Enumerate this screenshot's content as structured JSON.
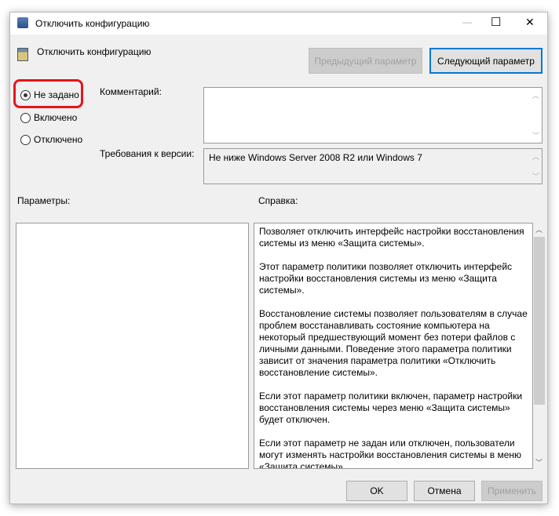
{
  "window": {
    "title": "Отключить конфигурацию",
    "minimize": "—",
    "maximize": "☐",
    "close": "✕"
  },
  "header": {
    "policy_name": "Отключить конфигурацию",
    "prev_button": "Предыдущий параметр",
    "next_button": "Следующий параметр"
  },
  "state": {
    "options": [
      {
        "label": "Не задано",
        "selected": true
      },
      {
        "label": "Включено",
        "selected": false
      },
      {
        "label": "Отключено",
        "selected": false
      }
    ]
  },
  "comment": {
    "label": "Комментарий:",
    "value": ""
  },
  "requirements": {
    "label": "Требования к версии:",
    "value": "Не ниже Windows Server 2008 R2 или Windows 7"
  },
  "params": {
    "label": "Параметры:"
  },
  "help": {
    "label": "Справка:",
    "paragraphs": [
      "Позволяет отключить интерфейс настройки восстановления системы из меню «Защита системы».",
      "Этот параметр политики позволяет отключить интерфейс настройки восстановления системы из меню «Защита системы».",
      "Восстановление системы позволяет пользователям в случае проблем восстанавливать состояние компьютера на некоторый предшествующий момент без потери файлов с личными данными. Поведение этого параметра политики зависит от значения параметра политики «Отключить восстановление системы».",
      "Если этот параметр политики включен, параметр настройки восстановления системы через меню «Защита системы» будет отключен.",
      "Если этот параметр не задан или отключен, пользователи могут изменять настройки восстановления системы в меню «Защита системы»."
    ]
  },
  "footer": {
    "ok": "OK",
    "cancel": "Отмена",
    "apply": "Применить"
  },
  "colors": {
    "highlight": "#e8141b",
    "accent": "#0078d7"
  }
}
